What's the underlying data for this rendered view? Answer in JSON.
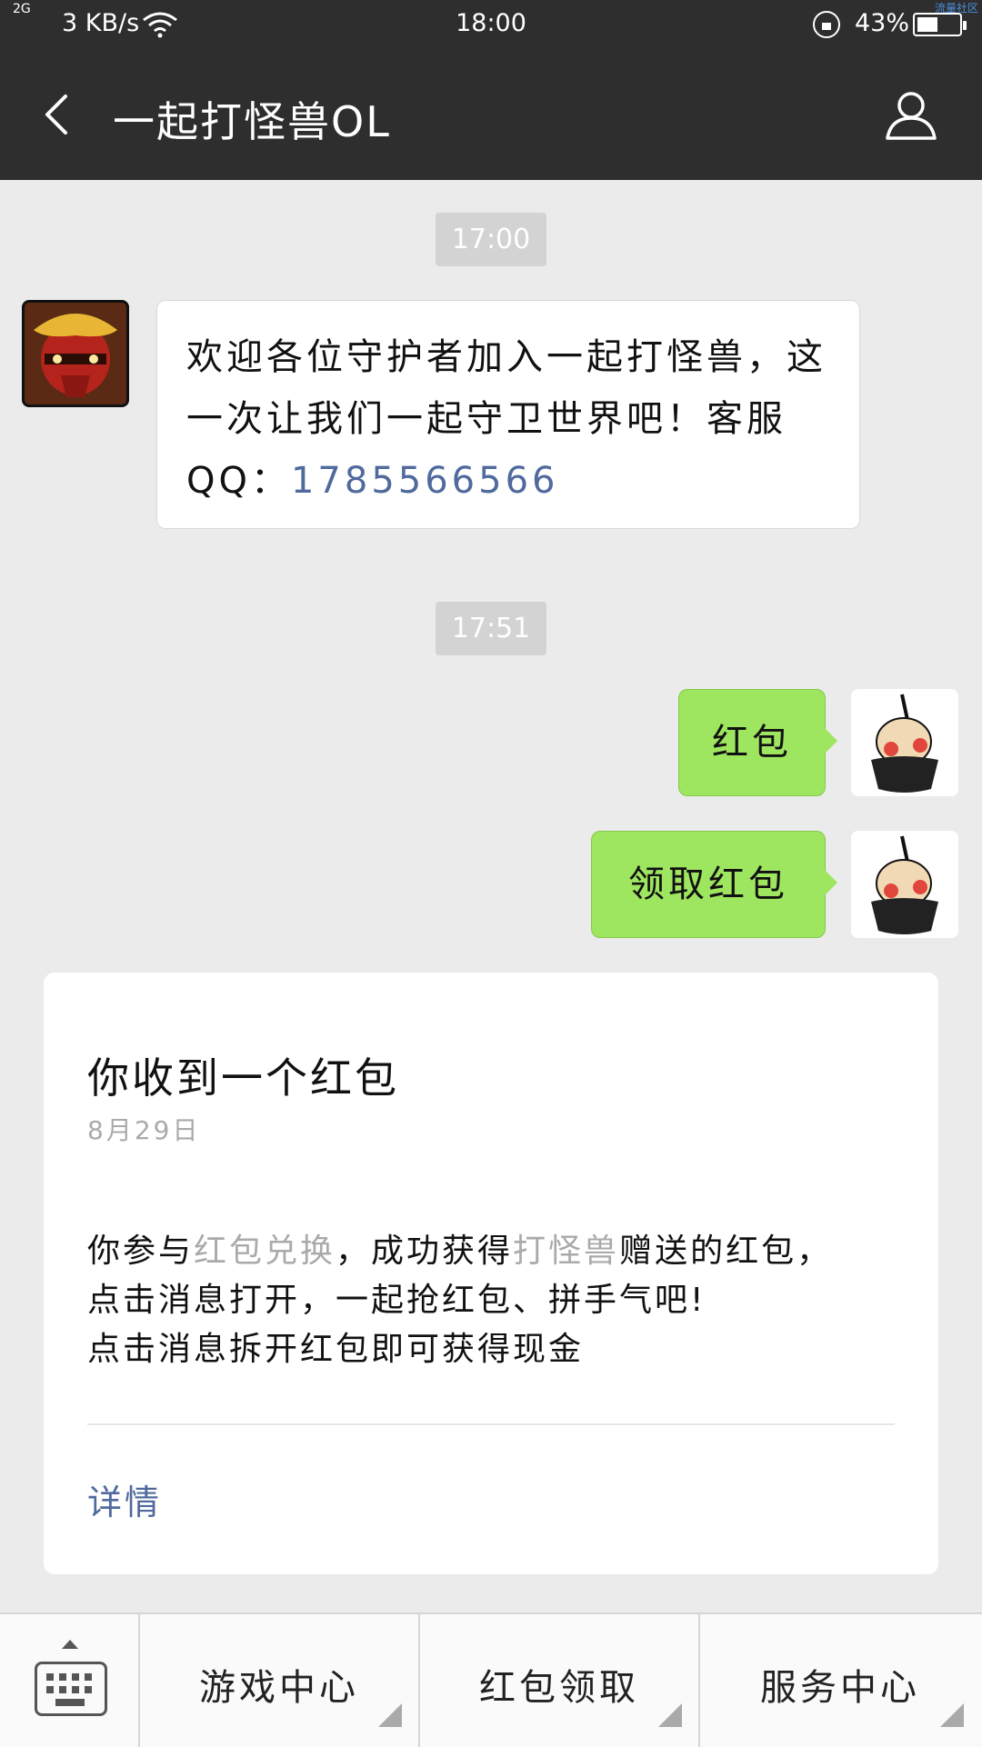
{
  "status_bar": {
    "signal": "2G",
    "net_speed": "3 KB/s",
    "time": "18:00",
    "battery_percent": "43%",
    "battery_level": 0.43,
    "corner_text": "流量社区"
  },
  "header": {
    "title": "一起打怪兽OL"
  },
  "chat": {
    "timestamp_1": "17:00",
    "welcome_text": "欢迎各位守护者加入一起打怪兽，这一次让我们一起守卫世界吧！客服QQ：",
    "welcome_qq": "1785566566",
    "timestamp_2": "17:51",
    "sent_1": "红包",
    "sent_2": "领取红包"
  },
  "card": {
    "title": "你收到一个红包",
    "date": "8月29日",
    "body_1a": "你参与",
    "body_1b": "红包兑换",
    "body_1c": "，成功获得",
    "body_1d": "打怪兽",
    "body_1e": "赠送的红包，",
    "body_2": "点击消息打开，一起抢红包、拼手气吧!",
    "body_3": "点击消息拆开红包即可获得现金",
    "link": "详情"
  },
  "bottom_menu": {
    "items": [
      {
        "label": "游戏中心"
      },
      {
        "label": "红包领取"
      },
      {
        "label": "服务中心"
      }
    ]
  }
}
